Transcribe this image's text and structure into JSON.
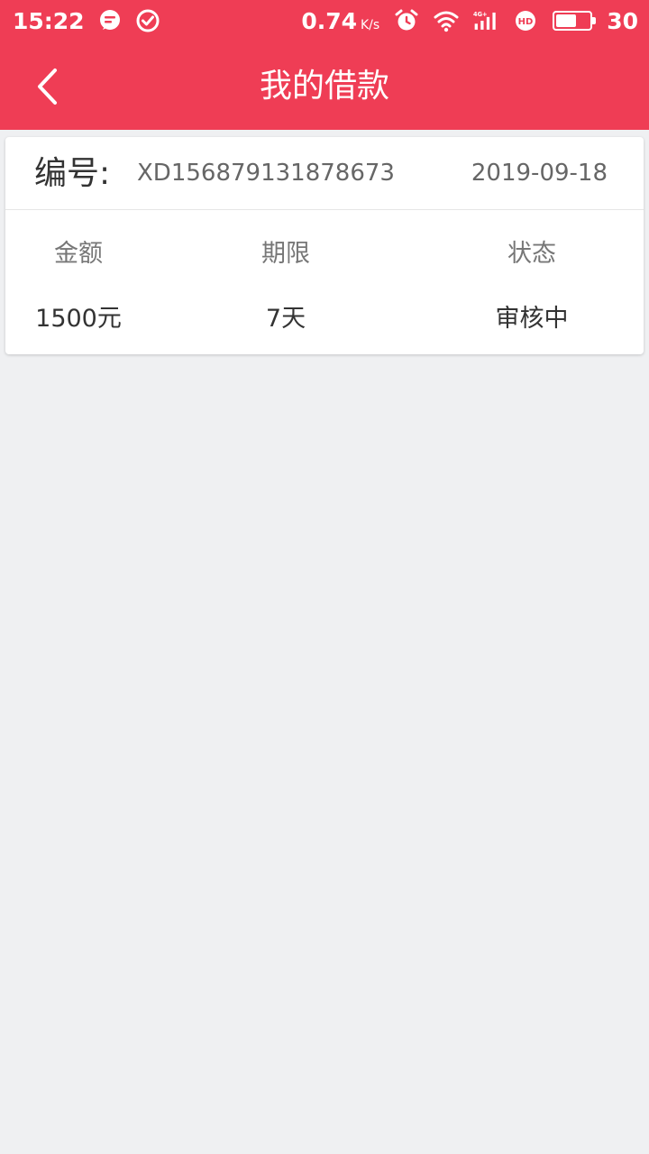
{
  "status_bar": {
    "time": "15:22",
    "speed_value": "0.74",
    "speed_unit": "K/s",
    "network": "4G+",
    "battery_level": "30",
    "battery_fraction": 0.6,
    "icons": [
      "message-icon",
      "check-circle-icon",
      "alarm-icon",
      "wifi-icon",
      "signal-icon",
      "hd-icon",
      "battery-icon"
    ]
  },
  "header": {
    "title": "我的借款",
    "background": "#ef3d55"
  },
  "loan": {
    "number_label": "编号:",
    "number": "XD156879131878673",
    "date": "2019-09-18",
    "amount_label": "金额",
    "amount": "1500元",
    "term_label": "期限",
    "term": "7天",
    "status_label": "状态",
    "status": "审核中"
  }
}
